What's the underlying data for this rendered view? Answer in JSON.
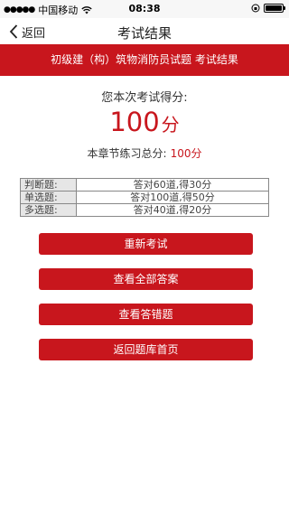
{
  "status_bar": {
    "carrier": "中国移动",
    "time": "08:38"
  },
  "nav": {
    "back_label": "返回",
    "title": "考试结果"
  },
  "banner": {
    "text": "初级建（构）筑物消防员试题 考试结果"
  },
  "result": {
    "score_label": "您本次考试得分:",
    "score": "100",
    "score_unit": "分",
    "total_label": "本章节练习总分:",
    "total_value": "100分"
  },
  "breakdown": [
    {
      "type": "判断题:",
      "detail": "答对60道,得30分"
    },
    {
      "type": "单选题:",
      "detail": "答对100道,得50分"
    },
    {
      "type": "多选题:",
      "detail": "答对40道,得20分"
    }
  ],
  "actions": {
    "retake": "重新考试",
    "view_all": "查看全部答案",
    "view_wrong": "查看答错题",
    "back_home": "返回题库首页"
  },
  "colors": {
    "accent": "#c8161d",
    "table_label_bg": "#e6e6e6"
  }
}
